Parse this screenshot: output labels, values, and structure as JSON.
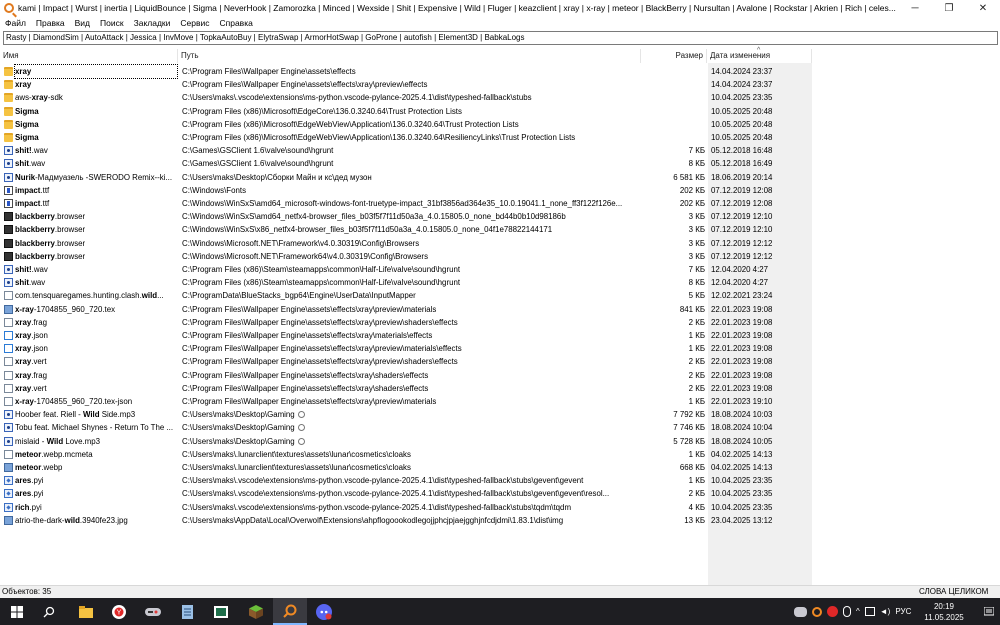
{
  "window": {
    "title": "kami | Impact | Wurst | inertia | LiquidBounce | Sigma | NeverHook | Zamorozka | Minced | Wexside | Shit | Expensive | Wild | Fluger | keazclient | xray | x-ray | meteor | BlackBerry | Nursultan | Avalone | Rockstar | Akrien | Rich | celes... - Everything",
    "minimize": "─",
    "maximize": "❐",
    "close": "✕"
  },
  "menu": [
    "Файл",
    "Правка",
    "Вид",
    "Поиск",
    "Закладки",
    "Сервис",
    "Справка"
  ],
  "search": {
    "value": "Rasty | DiamondSim | AutoAttack | Jessica | InvMove | TopkaAutoBuy | ElytraSwap | ArmorHotSwap | GoProne | autofish | Element3D | BabkaLogs"
  },
  "columns": {
    "name": "Имя",
    "path": "Путь",
    "size": "Размер",
    "date": "Дата изменения"
  },
  "rows": [
    {
      "icon": "folder",
      "pre": "",
      "hl": "xray",
      "post": "",
      "path": "C:\\Program Files\\Wallpaper Engine\\assets\\effects",
      "size": "",
      "date": "14.04.2024 23:37"
    },
    {
      "icon": "folder",
      "pre": "",
      "hl": "xray",
      "post": "",
      "path": "C:\\Program Files\\Wallpaper Engine\\assets\\effects\\xray\\preview\\effects",
      "size": "",
      "date": "14.04.2024 23:37"
    },
    {
      "icon": "folder",
      "pre": "aws-",
      "hl": "xray",
      "post": "-sdk",
      "path": "C:\\Users\\maks\\.vscode\\extensions\\ms-python.vscode-pylance-2025.4.1\\dist\\typeshed-fallback\\stubs",
      "size": "",
      "date": "10.04.2025 23:35"
    },
    {
      "icon": "folder",
      "pre": "",
      "hl": "Sigma",
      "post": "",
      "path": "C:\\Program Files (x86)\\Microsoft\\EdgeCore\\136.0.3240.64\\Trust Protection Lists",
      "size": "",
      "date": "10.05.2025 20:48"
    },
    {
      "icon": "folder",
      "pre": "",
      "hl": "Sigma",
      "post": "",
      "path": "C:\\Program Files (x86)\\Microsoft\\EdgeWebView\\Application\\136.0.3240.64\\Trust Protection Lists",
      "size": "",
      "date": "10.05.2025 20:48"
    },
    {
      "icon": "folder",
      "pre": "",
      "hl": "Sigma",
      "post": "",
      "path": "C:\\Program Files (x86)\\Microsoft\\EdgeWebView\\Application\\136.0.3240.64\\ResiliencyLinks\\Trust Protection Lists",
      "size": "",
      "date": "10.05.2025 20:48"
    },
    {
      "icon": "audio",
      "pre": "",
      "hl": "shit!",
      "post": ".wav",
      "path": "C:\\Games\\GSClient 1.6\\valve\\sound\\hgrunt",
      "size": "7 КБ",
      "date": "05.12.2018 16:48"
    },
    {
      "icon": "audio",
      "pre": "",
      "hl": "shit",
      "post": ".wav",
      "path": "C:\\Games\\GSClient 1.6\\valve\\sound\\hgrunt",
      "size": "8 КБ",
      "date": "05.12.2018 16:49"
    },
    {
      "icon": "audio",
      "pre": "",
      "hl": "Nurik",
      "post": "-Мадмуазель -SWERODO Remix--ki...",
      "path": "C:\\Users\\maks\\Desktop\\Сборки Майн и кс\\дед музон",
      "size": "6 581 КБ",
      "date": "18.06.2019 20:14"
    },
    {
      "icon": "font",
      "pre": "",
      "hl": "impact",
      "post": ".ttf",
      "path": "C:\\Windows\\Fonts",
      "size": "202 КБ",
      "date": "07.12.2019 12:08"
    },
    {
      "icon": "font",
      "pre": "",
      "hl": "impact",
      "post": ".ttf",
      "path": "C:\\Windows\\WinSxS\\amd64_microsoft-windows-font-truetype-impact_31bf3856ad364e35_10.0.19041.1_none_ff3f122f126e...",
      "size": "202 КБ",
      "date": "07.12.2019 12:08"
    },
    {
      "icon": "app",
      "pre": "",
      "hl": "blackberry",
      "post": ".browser",
      "path": "C:\\Windows\\WinSxS\\amd64_netfx4-browser_files_b03f5f7f11d50a3a_4.0.15805.0_none_bd44b0b10d98186b",
      "size": "3 КБ",
      "date": "07.12.2019 12:10"
    },
    {
      "icon": "app",
      "pre": "",
      "hl": "blackberry",
      "post": ".browser",
      "path": "C:\\Windows\\WinSxS\\x86_netfx4-browser_files_b03f5f7f11d50a3a_4.0.15805.0_none_04f1e78822144171",
      "size": "3 КБ",
      "date": "07.12.2019 12:10"
    },
    {
      "icon": "app",
      "pre": "",
      "hl": "blackberry",
      "post": ".browser",
      "path": "C:\\Windows\\Microsoft.NET\\Framework\\v4.0.30319\\Config\\Browsers",
      "size": "3 КБ",
      "date": "07.12.2019 12:12"
    },
    {
      "icon": "app",
      "pre": "",
      "hl": "blackberry",
      "post": ".browser",
      "path": "C:\\Windows\\Microsoft.NET\\Framework64\\v4.0.30319\\Config\\Browsers",
      "size": "3 КБ",
      "date": "07.12.2019 12:12"
    },
    {
      "icon": "audio",
      "pre": "",
      "hl": "shit!",
      "post": ".wav",
      "path": "C:\\Program Files (x86)\\Steam\\steamapps\\common\\Half-Life\\valve\\sound\\hgrunt",
      "size": "7 КБ",
      "date": "12.04.2020 4:27"
    },
    {
      "icon": "audio",
      "pre": "",
      "hl": "shit",
      "post": ".wav",
      "path": "C:\\Program Files (x86)\\Steam\\steamapps\\common\\Half-Life\\valve\\sound\\hgrunt",
      "size": "8 КБ",
      "date": "12.04.2020 4:27"
    },
    {
      "icon": "file",
      "pre": "com.tensquaregames.hunting.clash.",
      "hl": "wild",
      "post": "...",
      "path": "C:\\ProgramData\\BlueStacks_bgp64\\Engine\\UserData\\InputMapper",
      "size": "5 КБ",
      "date": "12.02.2021 23:24"
    },
    {
      "icon": "image",
      "pre": "",
      "hl": "x-ray",
      "post": "-1704855_960_720.tex",
      "path": "C:\\Program Files\\Wallpaper Engine\\assets\\effects\\xray\\preview\\materials",
      "size": "841 КБ",
      "date": "22.01.2023 19:08"
    },
    {
      "icon": "file",
      "pre": "",
      "hl": "xray",
      "post": ".frag",
      "path": "C:\\Program Files\\Wallpaper Engine\\assets\\effects\\xray\\preview\\shaders\\effects",
      "size": "2 КБ",
      "date": "22.01.2023 19:08"
    },
    {
      "icon": "json",
      "pre": "",
      "hl": "xray",
      "post": ".json",
      "path": "C:\\Program Files\\Wallpaper Engine\\assets\\effects\\xray\\materials\\effects",
      "size": "1 КБ",
      "date": "22.01.2023 19:08"
    },
    {
      "icon": "json",
      "pre": "",
      "hl": "xray",
      "post": ".json",
      "path": "C:\\Program Files\\Wallpaper Engine\\assets\\effects\\xray\\preview\\materials\\effects",
      "size": "1 КБ",
      "date": "22.01.2023 19:08"
    },
    {
      "icon": "file",
      "pre": "",
      "hl": "xray",
      "post": ".vert",
      "path": "C:\\Program Files\\Wallpaper Engine\\assets\\effects\\xray\\preview\\shaders\\effects",
      "size": "2 КБ",
      "date": "22.01.2023 19:08"
    },
    {
      "icon": "file",
      "pre": "",
      "hl": "xray",
      "post": ".frag",
      "path": "C:\\Program Files\\Wallpaper Engine\\assets\\effects\\xray\\shaders\\effects",
      "size": "2 КБ",
      "date": "22.01.2023 19:08"
    },
    {
      "icon": "file",
      "pre": "",
      "hl": "xray",
      "post": ".vert",
      "path": "C:\\Program Files\\Wallpaper Engine\\assets\\effects\\xray\\shaders\\effects",
      "size": "2 КБ",
      "date": "22.01.2023 19:08"
    },
    {
      "icon": "file",
      "pre": "",
      "hl": "x-ray",
      "post": "-1704855_960_720.tex-json",
      "path": "C:\\Program Files\\Wallpaper Engine\\assets\\effects\\xray\\preview\\materials",
      "size": "1 КБ",
      "date": "22.01.2023 19:10"
    },
    {
      "icon": "audio",
      "pre": "Hoober feat. Riell - ",
      "hl": "Wild",
      "post": " Side.mp3",
      "path": "C:\\Users\\maks\\Desktop\\Gaming",
      "cloud": true,
      "size": "7 792 КБ",
      "date": "18.08.2024 10:03"
    },
    {
      "icon": "audio",
      "pre": "Tobu feat. Michael Shynes - Return To The ...",
      "hl": "",
      "post": "",
      "path": "C:\\Users\\maks\\Desktop\\Gaming",
      "cloud": true,
      "size": "7 746 КБ",
      "date": "18.08.2024 10:04"
    },
    {
      "icon": "audio",
      "pre": "mislaid - ",
      "hl": "Wild",
      "post": " Love.mp3",
      "path": "C:\\Users\\maks\\Desktop\\Gaming",
      "cloud": true,
      "size": "5 728 КБ",
      "date": "18.08.2024 10:05"
    },
    {
      "icon": "file",
      "pre": "",
      "hl": "meteor",
      "post": ".webp.mcmeta",
      "path": "C:\\Users\\maks\\.lunarclient\\textures\\assets\\lunar\\cosmetics\\cloaks",
      "size": "1 КБ",
      "date": "04.02.2025 14:13"
    },
    {
      "icon": "image",
      "pre": "",
      "hl": "meteor",
      "post": ".webp",
      "path": "C:\\Users\\maks\\.lunarclient\\textures\\assets\\lunar\\cosmetics\\cloaks",
      "size": "668 КБ",
      "date": "04.02.2025 14:13"
    },
    {
      "icon": "py",
      "pre": "",
      "hl": "ares",
      "post": ".pyi",
      "path": "C:\\Users\\maks\\.vscode\\extensions\\ms-python.vscode-pylance-2025.4.1\\dist\\typeshed-fallback\\stubs\\gevent\\gevent",
      "size": "1 КБ",
      "date": "10.04.2025 23:35"
    },
    {
      "icon": "py",
      "pre": "",
      "hl": "ares",
      "post": ".pyi",
      "path": "C:\\Users\\maks\\.vscode\\extensions\\ms-python.vscode-pylance-2025.4.1\\dist\\typeshed-fallback\\stubs\\gevent\\gevent\\resol...",
      "size": "2 КБ",
      "date": "10.04.2025 23:35"
    },
    {
      "icon": "py",
      "pre": "",
      "hl": "rich",
      "post": ".pyi",
      "path": "C:\\Users\\maks\\.vscode\\extensions\\ms-python.vscode-pylance-2025.4.1\\dist\\typeshed-fallback\\stubs\\tqdm\\tqdm",
      "size": "4 КБ",
      "date": "10.04.2025 23:35"
    },
    {
      "icon": "image",
      "pre": "atrio-the-dark-",
      "hl": "wild",
      "post": ".3940fe23.jpg",
      "path": "C:\\Users\\maks\\AppData\\Local\\Overwolf\\Extensions\\ahpflogoookodlegojjphcjpjaejgghjnfcdjdmi\\1.83.1\\dist\\img",
      "size": "13 КБ",
      "date": "23.04.2025 13:12"
    }
  ],
  "status": {
    "objects": "Объектов: 35",
    "mode": "СЛОВА ЦЕЛИКОМ"
  },
  "taskbar": {
    "apps": [
      "windows-start",
      "search",
      "file-explorer",
      "yandex-browser",
      "game-app",
      "notepad",
      "media-app",
      "minecraft",
      "everything",
      "discord"
    ],
    "tray_lang": "РУС",
    "time": "20:19",
    "date": "11.05.2025"
  },
  "colors": {
    "folder": "#f5c342",
    "date_column": "#f0f0f0",
    "taskbar": "#1e1e22",
    "accent": "#e07a1f"
  }
}
